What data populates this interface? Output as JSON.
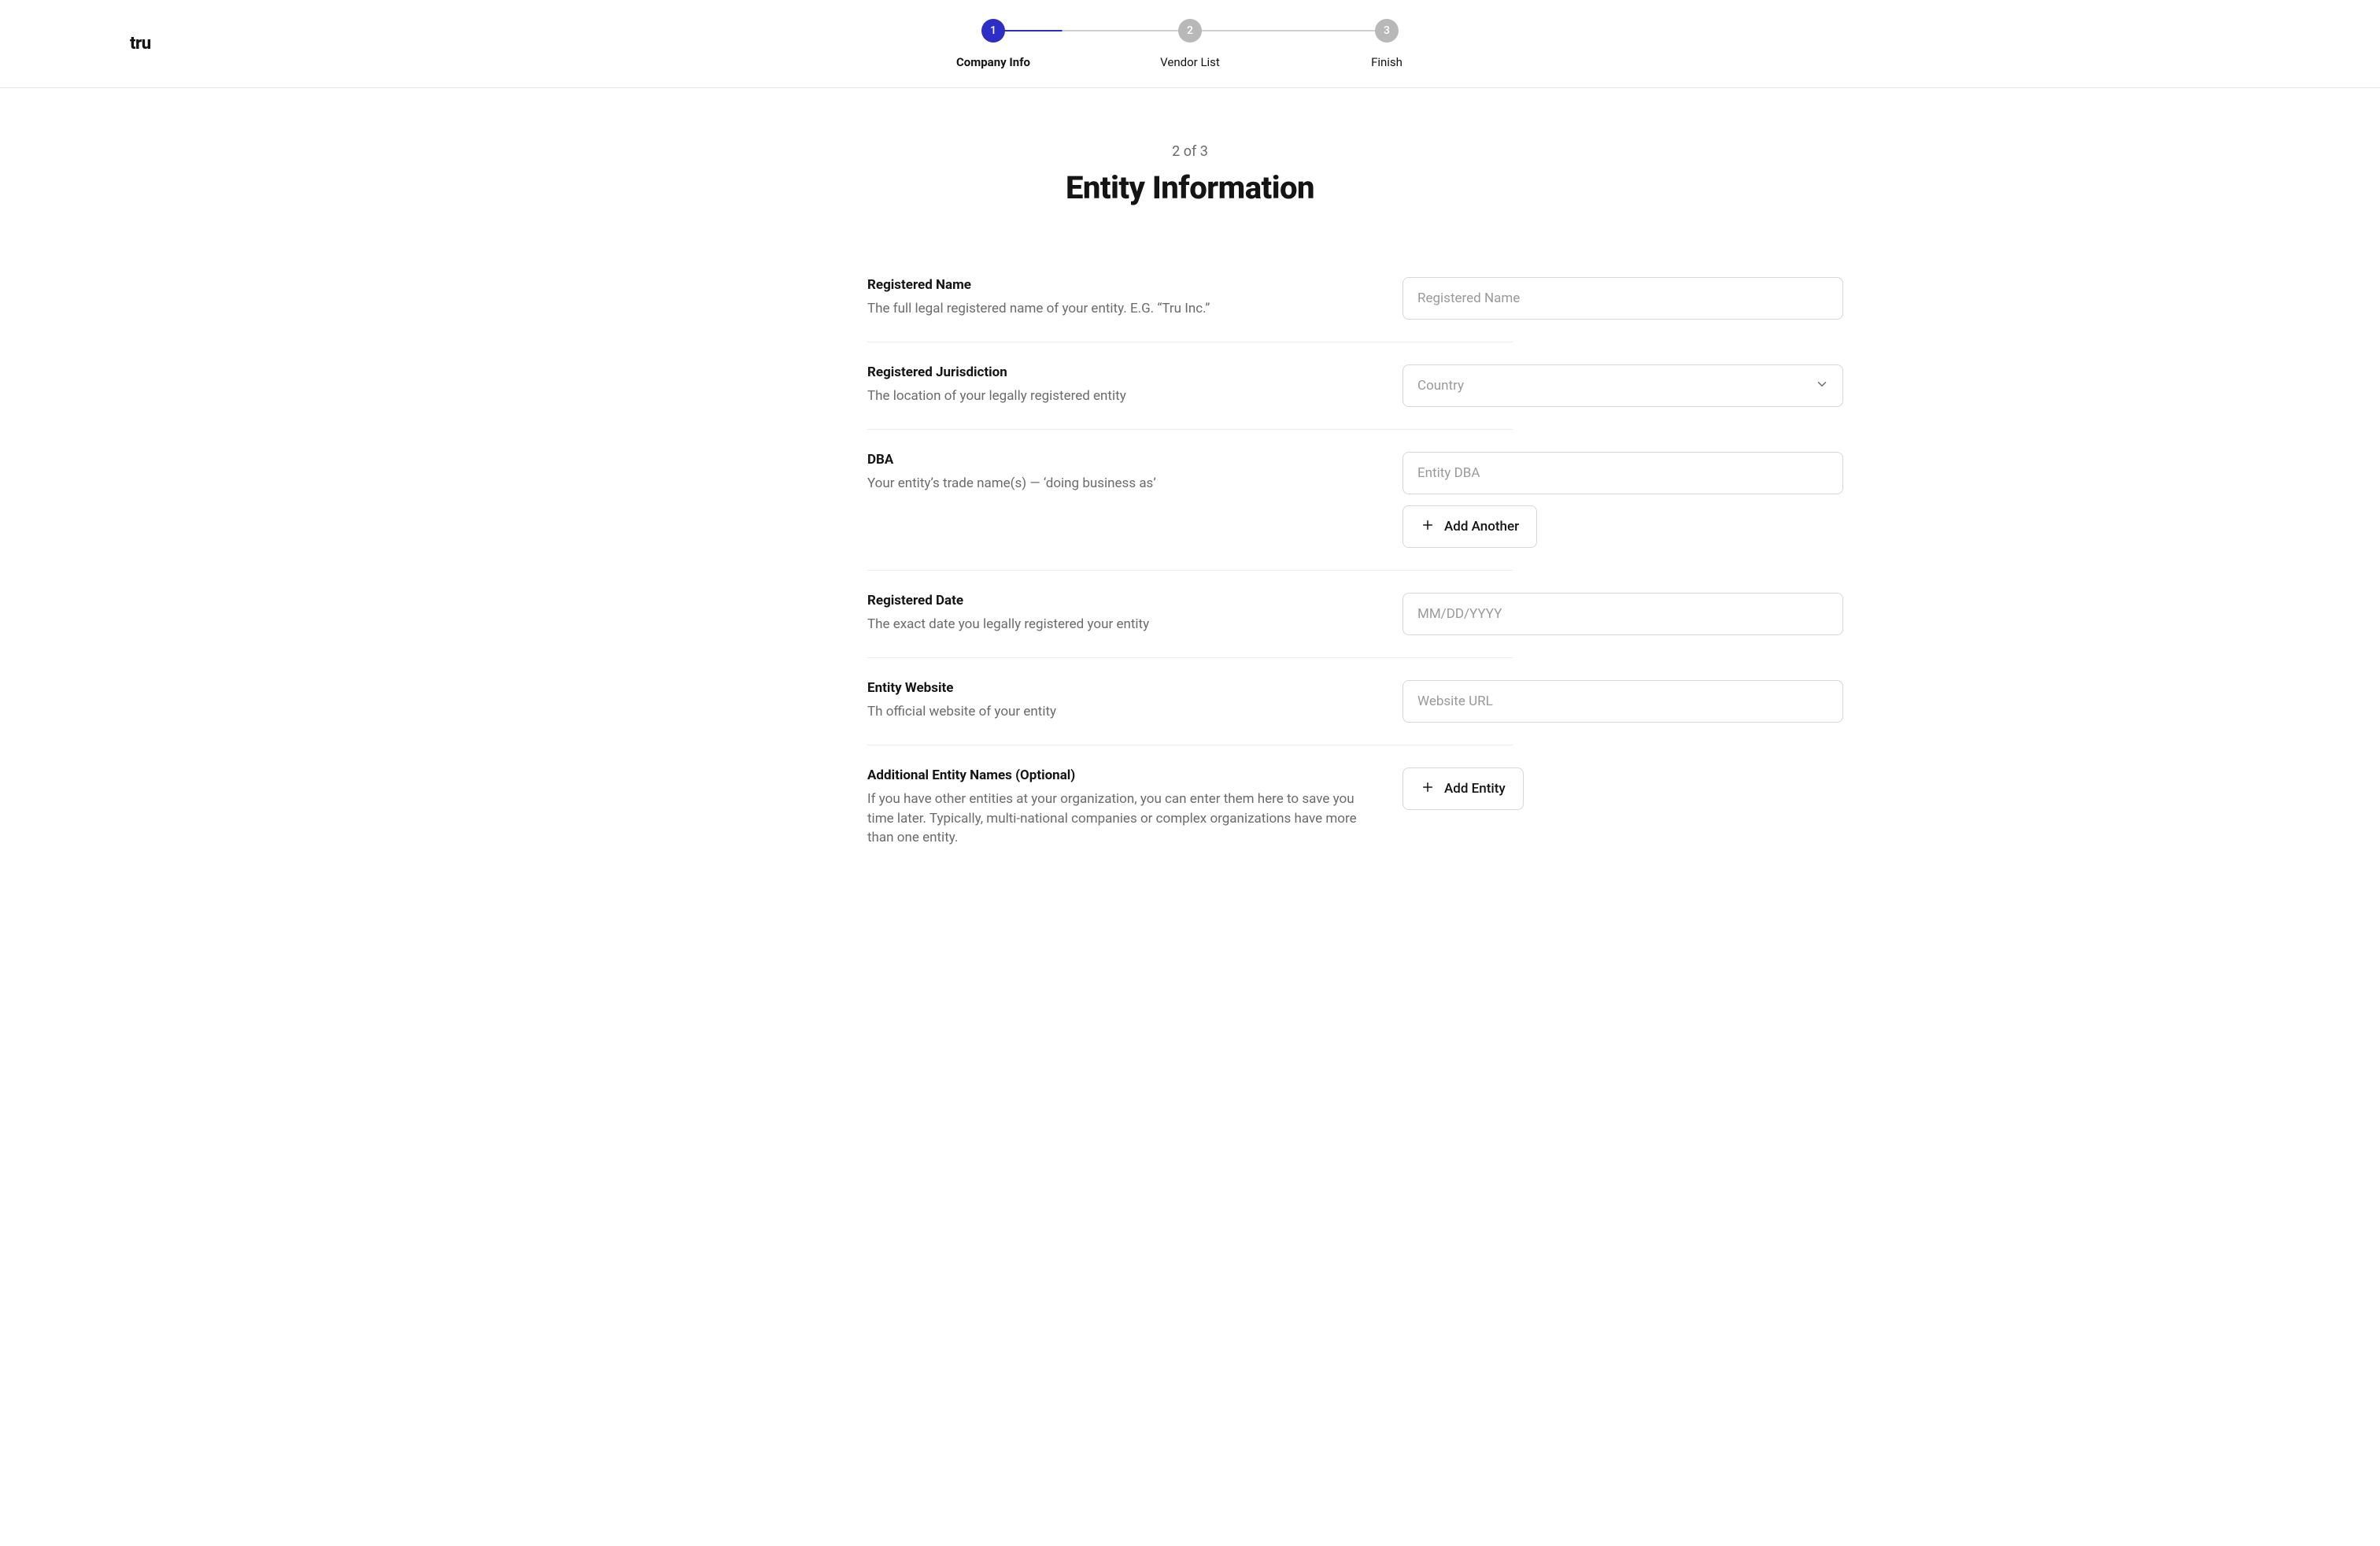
{
  "brand": "tru",
  "stepper": {
    "steps": [
      {
        "num": "1",
        "label": "Company Info",
        "state": "active"
      },
      {
        "num": "2",
        "label": "Vendor List",
        "state": "inactive"
      },
      {
        "num": "3",
        "label": "Finish",
        "state": "inactive"
      }
    ]
  },
  "page_count": "2 of 3",
  "page_title": "Entity Information",
  "fields": {
    "registered_name": {
      "label": "Registered Name",
      "help": "The full legal registered name of your entity. E.G. “Tru Inc.”",
      "placeholder": "Registered Name"
    },
    "jurisdiction": {
      "label": "Registered Jurisdiction",
      "help": "The location of your legally registered entity",
      "placeholder": "Country"
    },
    "dba": {
      "label": "DBA",
      "help": "Your entity’s trade name(s) — ‘doing business as’",
      "placeholder": "Entity DBA",
      "add_button": "Add Another"
    },
    "registered_date": {
      "label": "Registered Date",
      "help": "The exact date you legally registered your entity",
      "placeholder": "MM/DD/YYYY"
    },
    "website": {
      "label": "Entity Website",
      "help": "Th official website of your entity",
      "placeholder": "Website URL"
    },
    "additional": {
      "label": "Additional Entity Names (Optional)",
      "help": "If you have other entities at your organization, you can enter them here to save you time later. Typically, multi-national companies or complex organizations have more than one entity.",
      "add_button": "Add Entity"
    }
  }
}
